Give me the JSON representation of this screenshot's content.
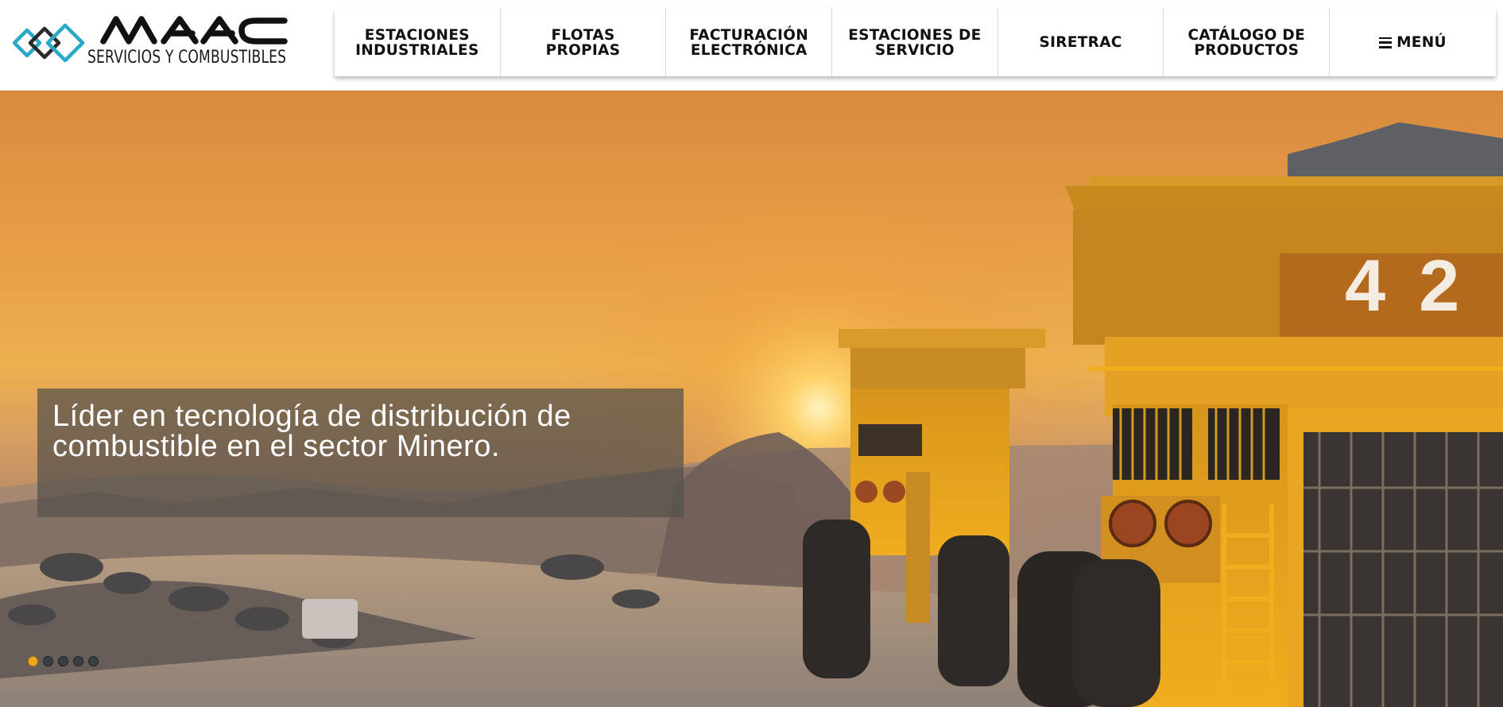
{
  "brand": {
    "name": "MAAC",
    "tagline": "SERVICIOS Y COMBUSTIBLES",
    "primary_color": "#111111",
    "accent_color": "#2aa8c8"
  },
  "nav": {
    "items": [
      {
        "label": "ESTACIONES\nINDUSTRIALES"
      },
      {
        "label": "FLOTAS PROPIAS"
      },
      {
        "label": "FACTURACIÓN\nELECTRÓNICA"
      },
      {
        "label": "ESTACIONES DE\nSERVICIO"
      },
      {
        "label": "SIRETRAC"
      },
      {
        "label": "CATÁLOGO DE\nPRODUCTOS"
      },
      {
        "label": "MENÚ",
        "icon": "hamburger-menu-icon"
      }
    ]
  },
  "hero": {
    "caption": "Líder en tecnología de distribución de combustible en el sector Minero.",
    "truck_numbers": [
      "4",
      "2"
    ],
    "slides": {
      "count": 5,
      "active_index": 1
    },
    "dot_active_color": "#f2a81b",
    "dot_inactive_color": "#3a3f44"
  }
}
